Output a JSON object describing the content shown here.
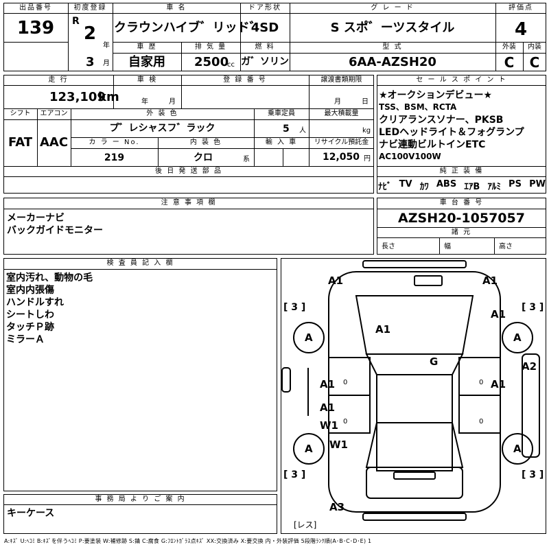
{
  "top": {
    "lot_label": "出品番号",
    "lot_value": "139",
    "first_reg_label": "初度登録",
    "era": "R",
    "year_value": "2",
    "year_unit": "年",
    "month_value": "3",
    "month_unit": "月",
    "car_name_label": "車 名",
    "car_name_value": "クラウンハイブ゛リッド゛",
    "history_label": "車 歴",
    "history_value": "自家用",
    "displacement_label": "排 気 量",
    "displacement_value": "2500",
    "displacement_unit": "cc",
    "door_label": "ドア形状",
    "door_value": "4SD",
    "fuel_label": "燃 料",
    "fuel_value": "ガ゛ソリン",
    "grade_label": "グ レ ー ド",
    "grade_value": "S スポ゛ーツスタイル",
    "model_label": "型 式",
    "model_value": "6AA-AZSH20",
    "score_label": "評価点",
    "score_value": "4",
    "ext_label": "外装",
    "ext_value": "C",
    "int_label": "内装",
    "int_value": "C"
  },
  "mid": {
    "mileage_label": "走 行",
    "mileage_value": "123,109",
    "mileage_unit": "km",
    "inspection_label": "車 検",
    "inspection_year": "年",
    "inspection_month": "月",
    "regno_label": "登 録 番 号",
    "transfer_label": "譲渡書類期限",
    "transfer_month": "月",
    "transfer_day": "日",
    "shift_label": "シフト",
    "shift_value": "FAT",
    "ac_label": "エアコン",
    "ac_value": "AAC",
    "exterior_color_label": "外 装 色",
    "exterior_color_value": "プ゛レシャスフ゛ラック",
    "capacity_label": "乗車定員",
    "capacity_value": "5",
    "capacity_unit": "人",
    "load_label": "最大積載量",
    "load_unit": "kg",
    "color_no_label": "カ ラ ー No.",
    "color_no_value": "219",
    "interior_color_label": "内 装 色",
    "interior_color_value": "クロ",
    "interior_color_unit": "系",
    "import_label": "輸 入 車",
    "recycle_label": "リサイクル預託金",
    "recycle_value": "12,050",
    "recycle_unit": "円",
    "later_label": "後 日 発 送 部 品"
  },
  "sales": {
    "label": "セ ー ル ス ポ イ ン ト",
    "lines": [
      "★オークションデビュー★",
      "TSS、BSM、RCTA",
      "クリアランスソナー、PKSB",
      "LEDヘッドライト＆フォグランプ",
      "ナビ連動ビルトインETC",
      "AC100V100W"
    ]
  },
  "equip": {
    "label": "純 正 装 備",
    "items": [
      "ﾅﾋﾞ",
      "TV",
      "ｶﾜ",
      "ABS",
      "ｴｱB",
      "ｱﾙﾐ",
      "PS",
      "PW"
    ]
  },
  "notes": {
    "label": "注 意 事 項 欄",
    "lines": [
      "メーカーナビ",
      "バックガイドモニター"
    ]
  },
  "chassis": {
    "label": "車 台 番 号",
    "value": "AZSH20-1057057",
    "dims_label": "諸 元",
    "length_label": "長さ",
    "width_label": "幅",
    "height_label": "高さ"
  },
  "inspector": {
    "label": "検 査 員 記 入 欄",
    "lines": [
      "室内汚れ、動物の毛",
      "室内内張傷",
      "ハンドルすれ",
      "シートしわ",
      "タッチＰ跡",
      "ミラーＡ"
    ]
  },
  "office": {
    "label": "事 務 局 よ り ご 案 内",
    "lines": [
      "キーケース"
    ]
  },
  "diagram": {
    "labels": [
      {
        "id": "front-left",
        "text": "A1"
      },
      {
        "id": "front-right",
        "text": "A1"
      },
      {
        "id": "side-left",
        "text": "[ 3 ]"
      },
      {
        "id": "side-right",
        "text": "[ 3 ]"
      },
      {
        "id": "fender-right",
        "text": "A1"
      },
      {
        "id": "wheel-fl",
        "text": "A"
      },
      {
        "id": "wheel-fr",
        "text": "A"
      },
      {
        "id": "bonnet",
        "text": "A1"
      },
      {
        "id": "glass",
        "text": "G"
      },
      {
        "id": "quarter-right",
        "text": "A2"
      },
      {
        "id": "door-fl",
        "text": "A1"
      },
      {
        "id": "door-fr",
        "text": "A1"
      },
      {
        "id": "door-rl",
        "text": "A1"
      },
      {
        "id": "door-rl2",
        "text": "W1"
      },
      {
        "id": "step-left",
        "text": "W1"
      },
      {
        "id": "wheel-rl",
        "text": "A"
      },
      {
        "id": "wheel-rr",
        "text": "A"
      },
      {
        "id": "bottom-left",
        "text": "[ 3 ]"
      },
      {
        "id": "bottom-right",
        "text": "[ 3 ]"
      },
      {
        "id": "rear",
        "text": "A3"
      },
      {
        "id": "door-mark-fl",
        "text": "0"
      },
      {
        "id": "door-mark-fr",
        "text": "0"
      },
      {
        "id": "door-mark-rl",
        "text": "0"
      },
      {
        "id": "door-mark-rr",
        "text": "0"
      },
      {
        "id": "rest",
        "text": "[レス]"
      }
    ]
  },
  "legend": "A:ｷｽﾞ U:ﾍｺﾐ B:ｷｽﾞを伴うﾍｺﾐ P:要塗装 W:補修跡 S:錆 C:腐食 G:ﾌﾛﾝﾄｶﾞﾗｽ点ｷｽﾞ XX:交換済み X:要交換 内・外装評価 5段階ﾗﾝｸ順(A･B･C･D･E) 1"
}
